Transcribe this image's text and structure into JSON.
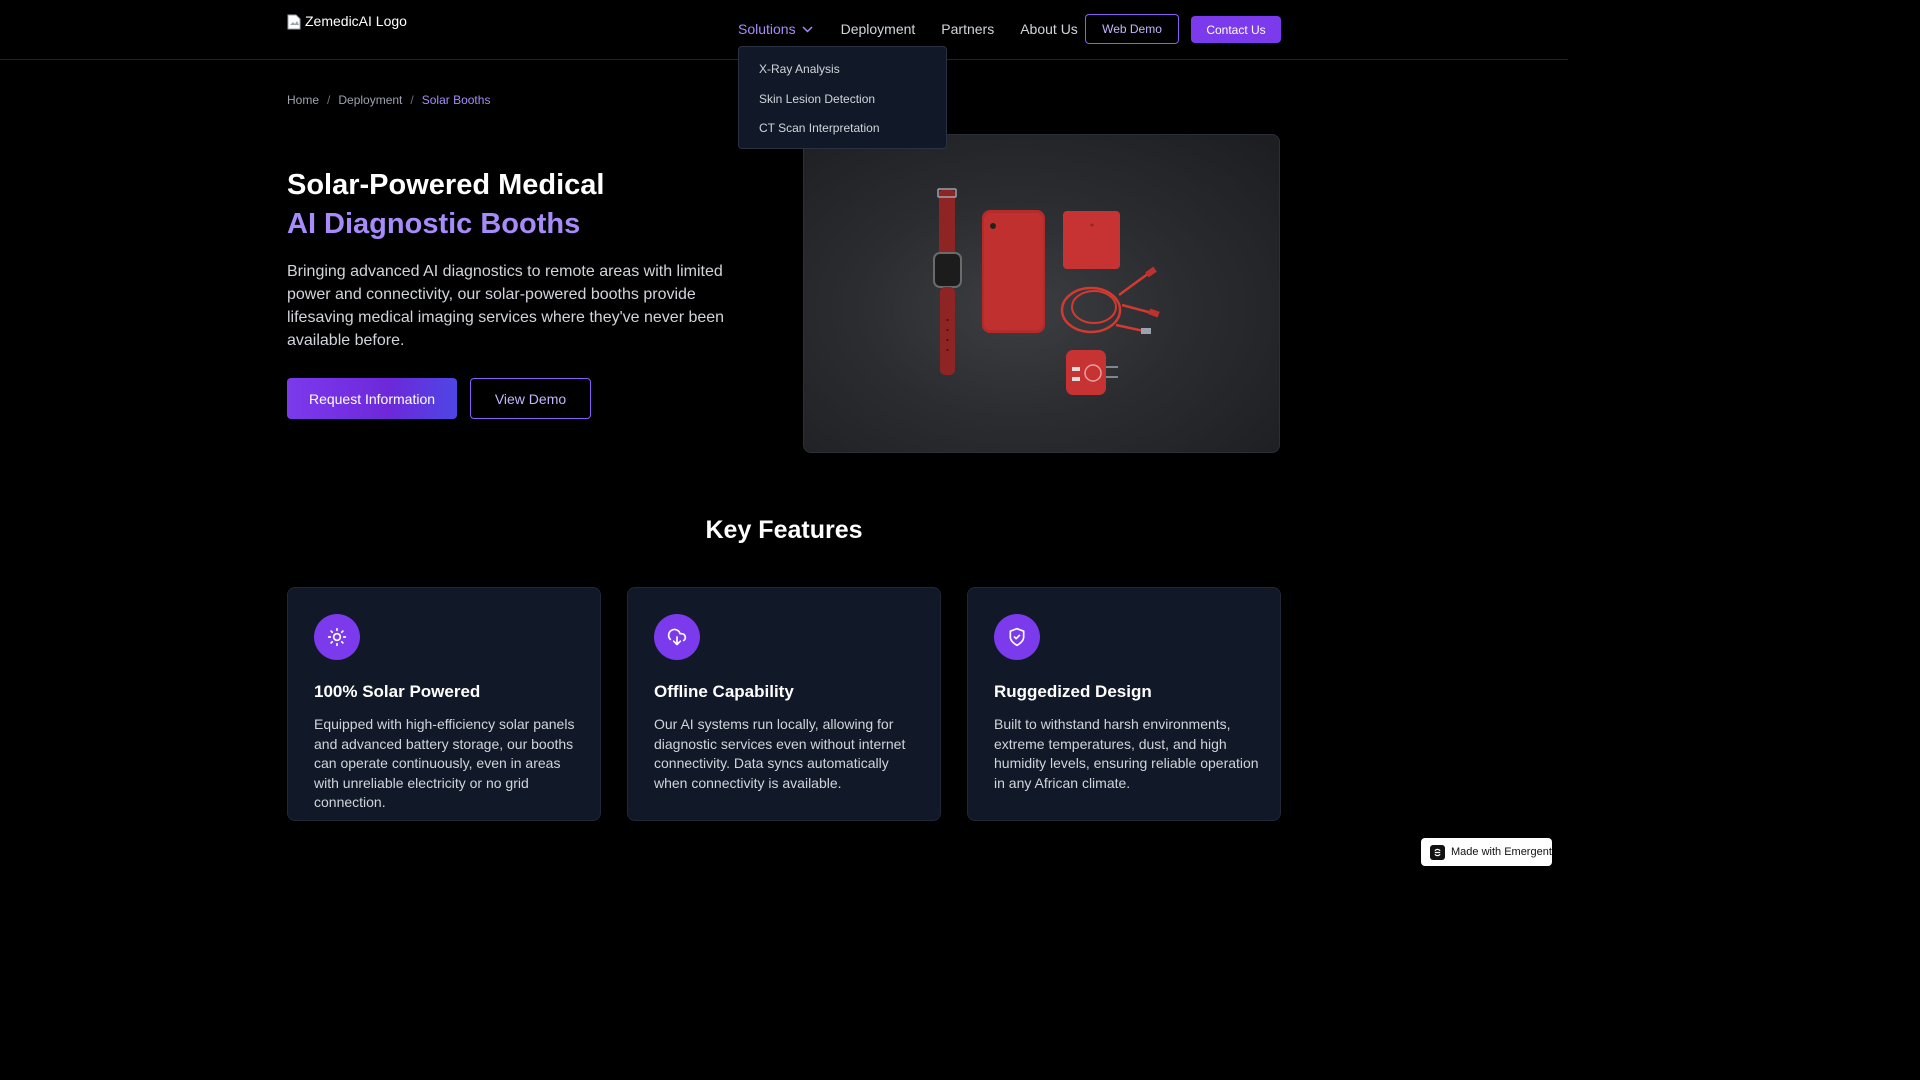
{
  "header": {
    "logo_alt": "ZemedicAI Logo",
    "nav": {
      "solutions": "Solutions",
      "deployment": "Deployment",
      "partners": "Partners",
      "about": "About Us"
    },
    "web_demo": "Web Demo",
    "contact": "Contact Us"
  },
  "dropdown": {
    "items": [
      "X-Ray Analysis",
      "Skin Lesion Detection",
      "CT Scan Interpretation"
    ]
  },
  "breadcrumb": {
    "home": "Home",
    "deployment": "Deployment",
    "current": "Solar Booths",
    "separator": "/"
  },
  "hero": {
    "title_line1": "Solar-Powered Medical",
    "title_line2": "AI Diagnostic Booths",
    "description": "Bringing advanced AI diagnostics to remote areas with limited power and connectivity, our solar-powered booths provide lifesaving medical imaging services where they've never been available before.",
    "request_button": "Request Information",
    "view_button": "View Demo"
  },
  "features": {
    "heading": "Key Features",
    "cards": [
      {
        "icon": "sun-icon",
        "title": "100% Solar Powered",
        "description": "Equipped with high-efficiency solar panels and advanced battery storage, our booths can operate continuously, even in areas with unreliable electricity or no grid connection."
      },
      {
        "icon": "cloud-download-icon",
        "title": "Offline Capability",
        "description": "Our AI systems run locally, allowing for diagnostic services even without internet connectivity. Data syncs automatically when connectivity is available."
      },
      {
        "icon": "shield-check-icon",
        "title": "Ruggedized Design",
        "description": "Built to withstand harsh environments, extreme temperatures, dust, and high humidity levels, ensuring reliable operation in any African climate."
      }
    ]
  },
  "badge": {
    "label": "Made with Emergent"
  },
  "colors": {
    "accent": "#7c3aed",
    "accent_light": "#a78bfa",
    "background": "#000000",
    "card": "#111827"
  }
}
